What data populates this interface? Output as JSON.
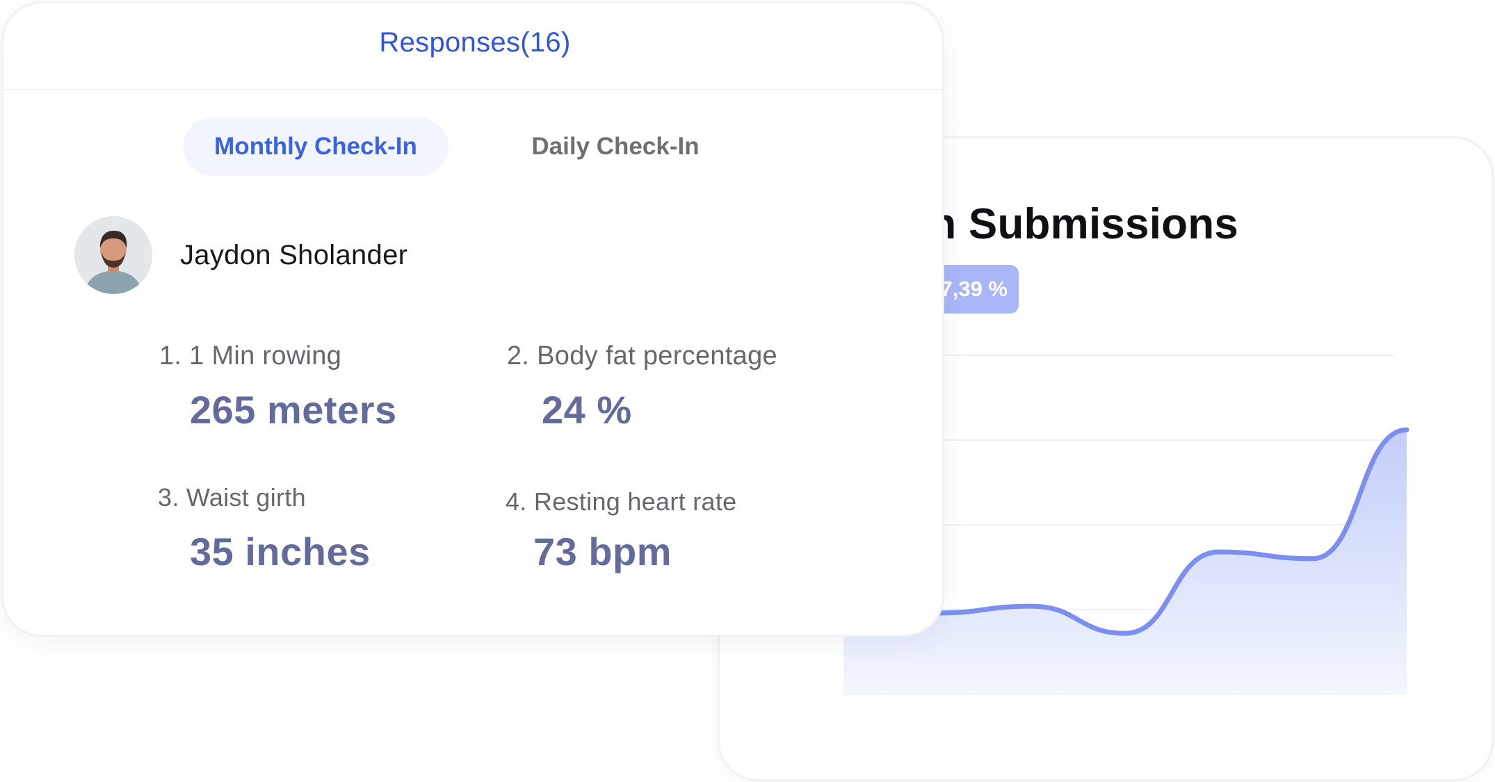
{
  "back_card": {
    "title": "n Submissions",
    "badge": "7,39 %"
  },
  "chart_data": {
    "type": "area",
    "series": [
      {
        "values": [
          30,
          24,
          26,
          18,
          42,
          40,
          78
        ]
      }
    ],
    "grid": true,
    "colors": {
      "line": "#7c8ff0",
      "fill_top": "#c9d3fb",
      "fill_bottom": "#f3f6fe",
      "grid": "#eef0f4"
    }
  },
  "card": {
    "title": "Responses(16)",
    "tabs": [
      {
        "label": "Monthly Check-In",
        "active": true
      },
      {
        "label": "Daily Check-In",
        "active": false
      }
    ],
    "user": {
      "name": "Jaydon Sholander"
    },
    "responses": [
      {
        "question": "1. 1 Min rowing",
        "answer": "265 meters"
      },
      {
        "question": "2. Body fat percentage",
        "answer": "24 %"
      },
      {
        "question": "3. Waist girth",
        "answer": "35 inches"
      },
      {
        "question": "4. Resting heart rate",
        "answer": "73 bpm"
      }
    ]
  },
  "colors": {
    "accent": "#2f54df",
    "tab_active_bg": "#f2f5fe",
    "value_text": "#626b9b",
    "badge_bg": "#a9b6f8"
  }
}
